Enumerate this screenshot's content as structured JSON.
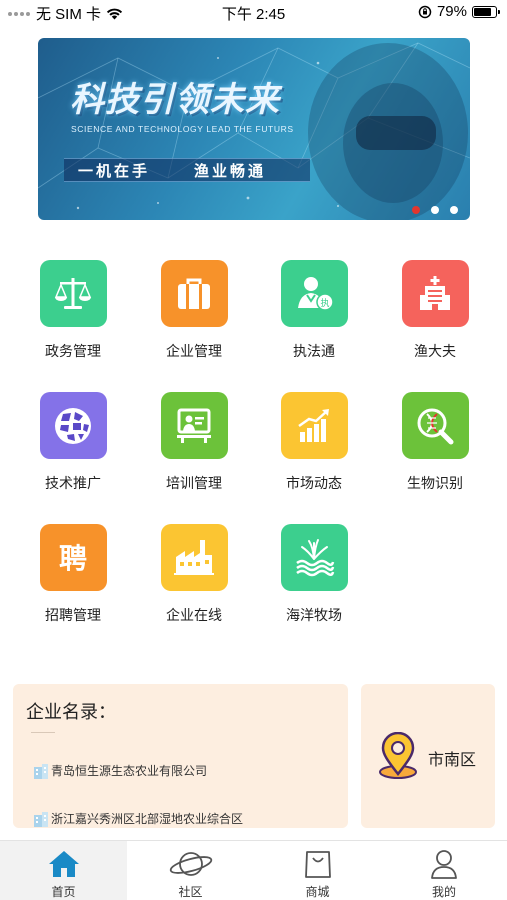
{
  "status_bar": {
    "carrier": "无 SIM 卡",
    "time": "下午 2:45",
    "battery": "79%",
    "battery_level": 0.79
  },
  "banner": {
    "title": "科技引领未来",
    "subtitle": "SCIENCE AND TECHNOLOGY LEAD THE FUTURS",
    "slogan_left": "一机在手",
    "slogan_right": "渔业畅通",
    "slide_count": 3,
    "active_slide": 0
  },
  "menu": [
    {
      "label": "政务管理",
      "icon": "scale-icon",
      "color": "#3ccf8e"
    },
    {
      "label": "企业管理",
      "icon": "briefcase-icon",
      "color": "#f7922a"
    },
    {
      "label": "执法通",
      "icon": "officer-icon",
      "color": "#3ccf8e"
    },
    {
      "label": "渔大夫",
      "icon": "hospital-icon",
      "color": "#f5635c"
    },
    {
      "label": "技术推广",
      "icon": "globe-icon",
      "color": "#8472e8"
    },
    {
      "label": "培训管理",
      "icon": "training-icon",
      "color": "#6cc23a"
    },
    {
      "label": "市场动态",
      "icon": "chart-icon",
      "color": "#fbc532"
    },
    {
      "label": "生物识别",
      "icon": "dna-search-icon",
      "color": "#6cc23a"
    },
    {
      "label": "招聘管理",
      "icon": "recruit-icon",
      "color": "#f7922a"
    },
    {
      "label": "企业在线",
      "icon": "factory-icon",
      "color": "#fbc532"
    },
    {
      "label": "海洋牧场",
      "icon": "sea-ranch-icon",
      "color": "#3ccf8e"
    }
  ],
  "directory": {
    "title": "企业名录：",
    "companies": [
      "青岛恒生源生态农业有限公司",
      "浙江嘉兴秀洲区北部湿地农业综合区"
    ]
  },
  "location": {
    "label": "市南区",
    "icon": "map-pin-icon"
  },
  "tabs": [
    {
      "label": "首页",
      "icon": "home-icon",
      "active": true
    },
    {
      "label": "社区",
      "icon": "planet-icon",
      "active": false
    },
    {
      "label": "商城",
      "icon": "shopping-bag-icon",
      "active": false
    },
    {
      "label": "我的",
      "icon": "user-icon",
      "active": false
    }
  ],
  "colors": {
    "accent": "#1a8ac6",
    "card_bg": "#fdeee0",
    "active_dot": "#e2362e"
  }
}
